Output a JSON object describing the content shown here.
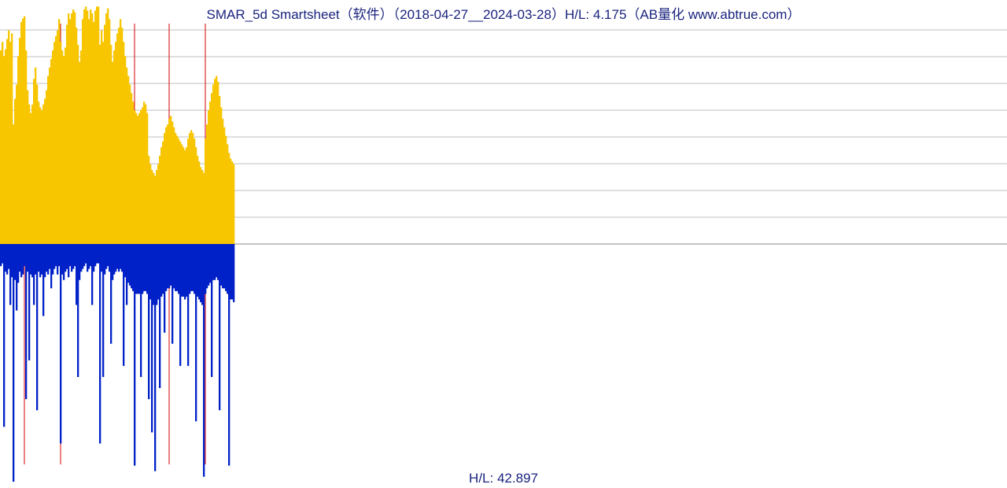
{
  "title": "SMAR_5d Smartsheet（软件）（2018-04-27__2024-03-28）H/L: 4.175（AB量化  www.abtrue.com）",
  "footer": "H/L: 42.897",
  "colors": {
    "up": "#f7c600",
    "down": "#0020c8",
    "grid": "#bfbfbf",
    "marker": "#d40000",
    "text": "#1a237e"
  },
  "chart_data": {
    "type": "bar",
    "title": "SMAR_5d Smartsheet（软件）（2018-04-27__2024-03-28）H/L: 4.175",
    "xlabel": "",
    "ylabel": "",
    "ylim_upper": [
      0,
      4.175
    ],
    "ylim_lower": [
      -42.897,
      0
    ],
    "grid_lines_upper_count": 9,
    "red_markers_x_index": [
      15,
      38,
      85,
      107,
      130
    ],
    "series": [
      {
        "name": "upper_yellow",
        "note": "values in H/L units (max 4.175), aligned to top panel",
        "values": [
          3.4,
          3.55,
          3.3,
          3.42,
          3.6,
          3.75,
          3.55,
          3.7,
          2.1,
          2.55,
          2.8,
          3.3,
          3.62,
          3.9,
          3.96,
          4.0,
          3.4,
          2.7,
          2.45,
          2.3,
          2.45,
          2.9,
          3.1,
          2.8,
          2.5,
          2.4,
          2.35,
          2.45,
          2.55,
          2.7,
          2.95,
          3.1,
          3.25,
          3.4,
          3.55,
          3.65,
          3.75,
          3.95,
          3.55,
          3.4,
          3.3,
          3.45,
          3.85,
          4.05,
          3.95,
          4.05,
          4.12,
          4.07,
          3.8,
          3.5,
          3.2,
          3.4,
          3.95,
          4.12,
          4.17,
          4.1,
          3.95,
          4.12,
          4.05,
          3.9,
          4.1,
          4.17,
          4.17,
          3.5,
          3.75,
          3.55,
          3.85,
          4.05,
          4.14,
          3.95,
          3.5,
          3.2,
          3.4,
          3.55,
          3.7,
          3.8,
          3.95,
          3.8,
          3.55,
          3.3,
          3.1,
          2.95,
          2.8,
          2.65,
          2.5,
          2.35,
          2.3,
          2.25,
          2.3,
          2.35,
          2.4,
          2.5,
          2.45,
          2.3,
          1.55,
          1.4,
          1.3,
          1.25,
          1.2,
          1.3,
          1.4,
          1.55,
          1.7,
          1.8,
          1.95,
          2.05,
          2.1,
          2.2,
          2.25,
          2.15,
          2.05,
          1.95,
          1.9,
          1.85,
          1.8,
          1.75,
          1.7,
          1.65,
          1.7,
          1.85,
          1.95,
          2.0,
          1.95,
          1.85,
          1.7,
          1.55,
          1.45,
          1.35,
          1.3,
          1.25,
          1.85,
          2.1,
          2.35,
          2.5,
          2.65,
          2.8,
          2.9,
          2.95,
          2.85,
          2.6,
          2.4,
          2.2,
          2.05,
          1.9,
          1.75,
          1.6,
          1.5,
          1.45,
          1.4
        ]
      },
      {
        "name": "lower_blue",
        "note": "values in H/L units (min -42.897), aligned to bottom panel",
        "values": [
          -4.0,
          -3.5,
          -33.0,
          -5.0,
          -5.5,
          -4.5,
          -11.0,
          -6.0,
          -42.9,
          -6.5,
          -12.0,
          -7.0,
          -5.0,
          -6.0,
          -5.5,
          -4.0,
          -28.0,
          -5.0,
          -21.0,
          -5.5,
          -6.0,
          -11.0,
          -5.5,
          -30.0,
          -5.0,
          -6.0,
          -5.5,
          -13.0,
          -6.0,
          -5.0,
          -5.5,
          -4.5,
          -8.0,
          -5.5,
          -4.5,
          -4.0,
          -5.5,
          -4.0,
          -36.0,
          -5.5,
          -6.5,
          -5.0,
          -4.5,
          -6.0,
          -4.0,
          -5.0,
          -4.5,
          -4.0,
          -11.0,
          -24.0,
          -6.5,
          -5.0,
          -4.5,
          -4.0,
          -3.5,
          -5.0,
          -4.5,
          -4.0,
          -11.0,
          -5.0,
          -4.0,
          -3.5,
          -3.5,
          -36.0,
          -5.0,
          -24.0,
          -5.5,
          -4.5,
          -4.0,
          -5.0,
          -18.0,
          -6.5,
          -5.5,
          -5.0,
          -4.5,
          -5.0,
          -4.5,
          -5.0,
          -22.0,
          -6.0,
          -11.0,
          -7.0,
          -7.5,
          -8.0,
          -8.5,
          -40.0,
          -9.0,
          -9.0,
          -9.0,
          -24.0,
          -9.0,
          -8.5,
          -8.5,
          -9.0,
          -28.0,
          -10.0,
          -34.0,
          -11.0,
          -41.0,
          -11.0,
          -10.0,
          -26.0,
          -9.5,
          -9.0,
          -16.0,
          -8.5,
          -8.0,
          -8.0,
          -7.5,
          -18.0,
          -8.0,
          -8.5,
          -8.5,
          -9.0,
          -22.0,
          -9.5,
          -9.5,
          -10.0,
          -9.5,
          -22.0,
          -9.0,
          -8.5,
          -8.5,
          -9.0,
          -32.0,
          -9.5,
          -10.0,
          -10.5,
          -11.0,
          -42.0,
          -9.0,
          -8.0,
          -7.5,
          -7.0,
          -24.0,
          -6.5,
          -6.5,
          -6.0,
          -6.5,
          -30.0,
          -7.5,
          -8.0,
          -8.0,
          -8.5,
          -9.0,
          -40.0,
          -10.0,
          -10.0,
          -10.5
        ]
      }
    ]
  }
}
